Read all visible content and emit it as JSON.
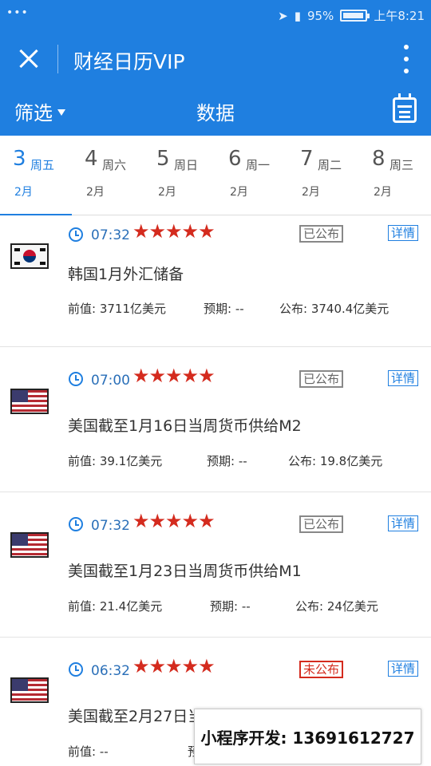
{
  "status_bar": {
    "dots": "•••",
    "battery": "95%",
    "time": "上午8:21"
  },
  "header": {
    "title": "财经日历VIP",
    "filter_label": "筛选",
    "subtitle": "数据"
  },
  "date_tabs": [
    {
      "day": "3",
      "weekday": "周五",
      "month": "2月",
      "active": true
    },
    {
      "day": "4",
      "weekday": "周六",
      "month": "2月"
    },
    {
      "day": "5",
      "weekday": "周日",
      "month": "2月"
    },
    {
      "day": "6",
      "weekday": "周一",
      "month": "2月"
    },
    {
      "day": "7",
      "weekday": "周二",
      "month": "2月"
    },
    {
      "day": "8",
      "weekday": "周三",
      "month": "2月"
    }
  ],
  "events": [
    {
      "country_flag": "south-korea-flag",
      "time": "07:32",
      "stars": "★★★★★",
      "star_rating": 5,
      "status": "已公布",
      "detail_label": "详情",
      "title": "韩国1月外汇储备",
      "previous": "前值: 3711亿美元",
      "forecast": "预期: --",
      "actual": "公布: 3740.4亿美元"
    },
    {
      "country_flag": "us-flag",
      "time": "07:00",
      "stars": "★★★★★",
      "star_rating": 5,
      "status": "已公布",
      "detail_label": "详情",
      "title": "美国截至1月16日当周货币供给M2",
      "previous": "前值: 39.1亿美元",
      "forecast": "预期: --",
      "actual": "公布: 19.8亿美元"
    },
    {
      "country_flag": "us-flag",
      "time": "07:32",
      "stars": "★★★★★",
      "star_rating": 5,
      "status": "已公布",
      "detail_label": "详情",
      "title": "美国截至1月23日当周货币供给M1",
      "previous": "前值: 21.4亿美元",
      "forecast": "预期: --",
      "actual": "公布: 24亿美元"
    },
    {
      "country_flag": "us-flag",
      "time": "06:32",
      "stars": "★★★★★",
      "star_rating": 5,
      "status": "未公布",
      "detail_label": "详情",
      "title": "美国截至2月27日当周外国央行持有美国国债",
      "previous": "前值: --",
      "forecast": "预",
      "actual": ""
    }
  ],
  "banner": {
    "text": "小程序开发: 13691612727"
  },
  "colors": {
    "primary": "#1f7fe0",
    "star": "#d42b1e",
    "unpublished": "#d42b1e"
  }
}
